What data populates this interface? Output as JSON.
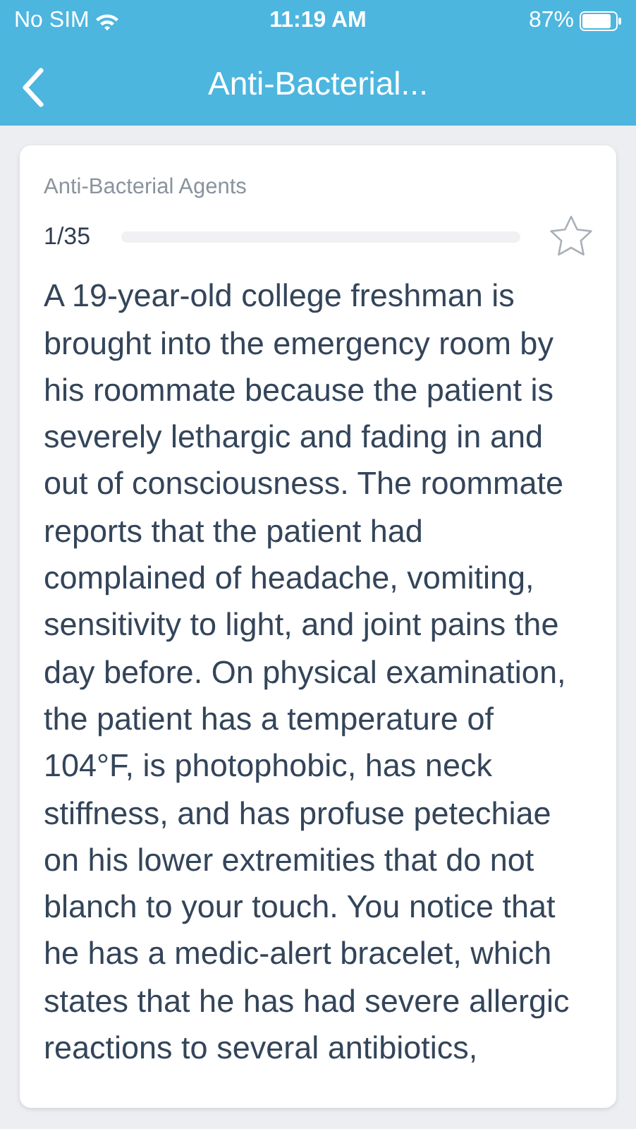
{
  "status_bar": {
    "carrier": "No SIM",
    "time": "11:19 AM",
    "battery": "87%"
  },
  "header": {
    "title": "Anti-Bacterial..."
  },
  "question": {
    "topic": "Anti-Bacterial Agents",
    "counter": "1/35",
    "bookmarked": false,
    "text": "A 19-year-old college freshman is brought into the emergency room by his roommate because the patient is severely lethargic and fading in and out of consciousness. The roommate reports that the patient had complained of headache, vomiting, sensitivity to light, and joint pains the day before. On physical examination, the patient has a temperature of 104°F, is photophobic, has neck stiffness, and has profuse petechiae on his lower extremities that do not blanch to your touch. You notice that he has a medic-alert bracelet, which states that he has had severe allergic reactions to several antibiotics,"
  }
}
